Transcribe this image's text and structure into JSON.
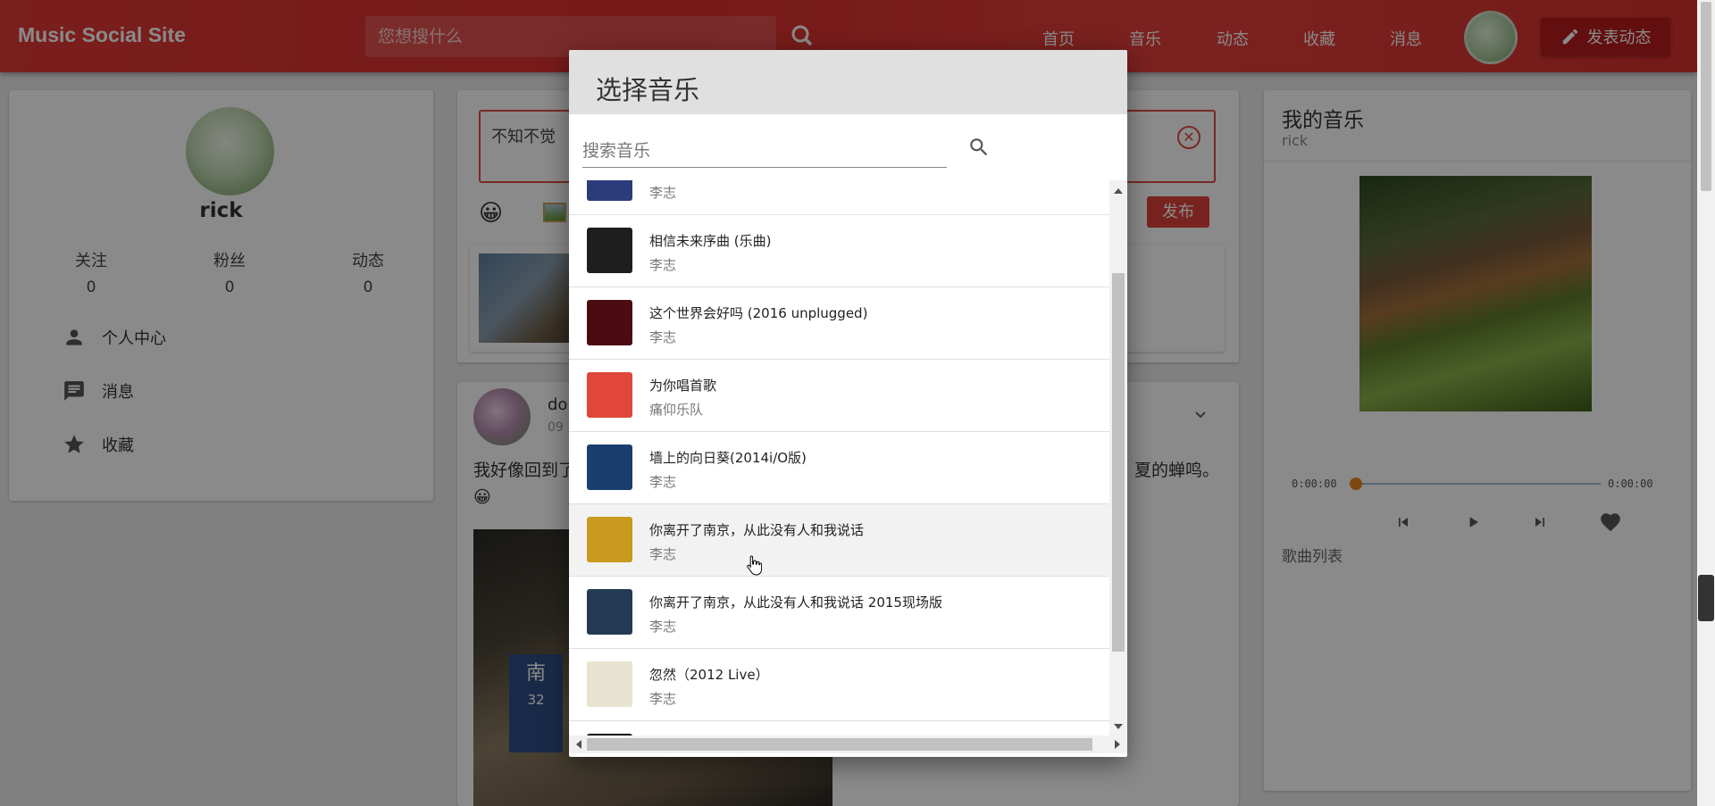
{
  "topbar": {
    "brand": "Music Social Site",
    "search_placeholder": "您想搜什么",
    "nav": [
      "首页",
      "音乐",
      "动态",
      "收藏",
      "消息"
    ],
    "post_button": "发表动态"
  },
  "profile": {
    "username": "rick",
    "stats": [
      {
        "label": "关注",
        "value": "0"
      },
      {
        "label": "粉丝",
        "value": "0"
      },
      {
        "label": "动态",
        "value": "0"
      }
    ],
    "menu": [
      "个人中心",
      "消息",
      "收藏"
    ]
  },
  "compose": {
    "text": "不知不觉",
    "publish": "发布"
  },
  "feed": {
    "name": "do",
    "time": "09",
    "text_start": "我好像回到了",
    "text_end": "夏的蝉鸣。",
    "emoji": "😀"
  },
  "player": {
    "title": "我的音乐",
    "user": "rick",
    "current_time": "0:00:00",
    "total_time": "0:00:00",
    "progress": 0,
    "playlist_label": "歌曲列表"
  },
  "modal": {
    "title": "选择音乐",
    "search_placeholder": "搜索音乐",
    "songs": [
      {
        "name": "",
        "artist": "李志",
        "art": "#2b3c7a"
      },
      {
        "name": "相信未来序曲 (乐曲)",
        "artist": "李志",
        "art": "#1e1e1e"
      },
      {
        "name": "这个世界会好吗 (2016 unplugged)",
        "artist": "李志",
        "art": "#4a0c10"
      },
      {
        "name": "为你唱首歌",
        "artist": "痛仰乐队",
        "art": "#e0473a"
      },
      {
        "name": "墙上的向日葵(2014i/O版)",
        "artist": "李志",
        "art": "#1a3f6e"
      },
      {
        "name": "你离开了南京，从此没有人和我说话",
        "artist": "李志",
        "art": "#c89a1e"
      },
      {
        "name": "你离开了南京，从此没有人和我说话 2015现场版",
        "artist": "李志",
        "art": "#243a52"
      },
      {
        "name": "忽然（2012 Live）",
        "artist": "李志",
        "art": "#e8e2d0"
      },
      {
        "name": "",
        "artist": "",
        "art": "#111111"
      }
    ]
  },
  "colors": {
    "brand_red": "#d9302e",
    "button_dark_red": "#b71c1c",
    "progress_dot": "#e8861f"
  }
}
